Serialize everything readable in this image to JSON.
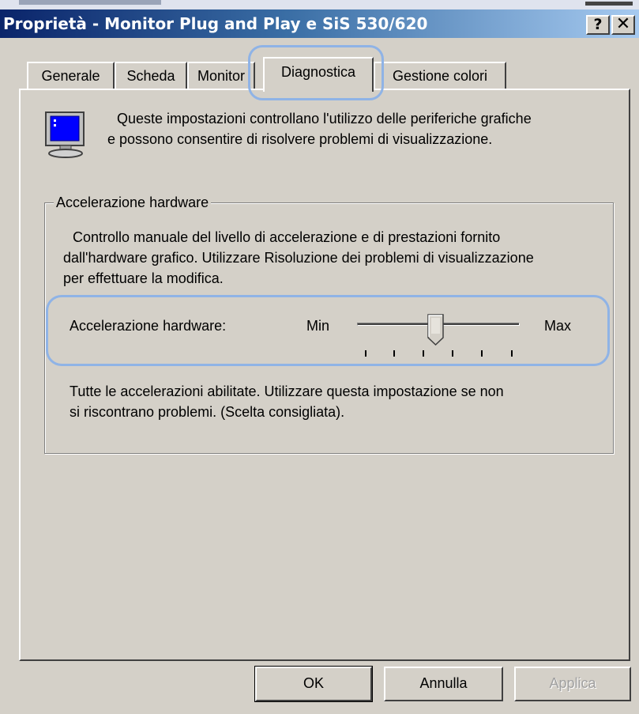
{
  "window": {
    "title": "Proprietà - Monitor Plug and Play e SiS 530/620",
    "help_button": "?",
    "close_button": "✕"
  },
  "tabs": [
    {
      "label": "Generale",
      "selected": false
    },
    {
      "label": "Scheda",
      "selected": false
    },
    {
      "label": "Monitor",
      "selected": false
    },
    {
      "label": "Diagnostica",
      "selected": true
    },
    {
      "label": "Gestione colori",
      "selected": false
    }
  ],
  "intro": {
    "line1": "Queste impostazioni controllano l'utilizzo delle periferiche grafiche",
    "line2": "e possono consentire di risolvere problemi di visualizzazione."
  },
  "hardware_group": {
    "title": "Accelerazione hardware",
    "desc_line1": "Controllo manuale del livello di accelerazione e di prestazioni fornito",
    "desc_line2": "dall'hardware grafico. Utilizzare Risoluzione dei problemi di visualizzazione",
    "desc_line3": "per effettuare la modifica.",
    "slider": {
      "label": "Accelerazione hardware:",
      "min_label": "Min",
      "max_label": "Max",
      "position": 3,
      "tick_count": 6
    },
    "status_line1": "Tutte le accelerazioni abilitate. Utilizzare questa impostazione se non",
    "status_line2": "si riscontrano problemi. (Scelta consigliata)."
  },
  "buttons": {
    "ok": "OK",
    "cancel": "Annulla",
    "apply": "Applica"
  },
  "colors": {
    "dialog_bg": "#d4d0c8",
    "title_gradient_start": "#0a246a",
    "title_gradient_end": "#a6caf0",
    "highlight": "#8fb3e6"
  },
  "icons": {
    "monitor": "monitor-icon",
    "help": "help-icon",
    "close": "close-icon"
  }
}
